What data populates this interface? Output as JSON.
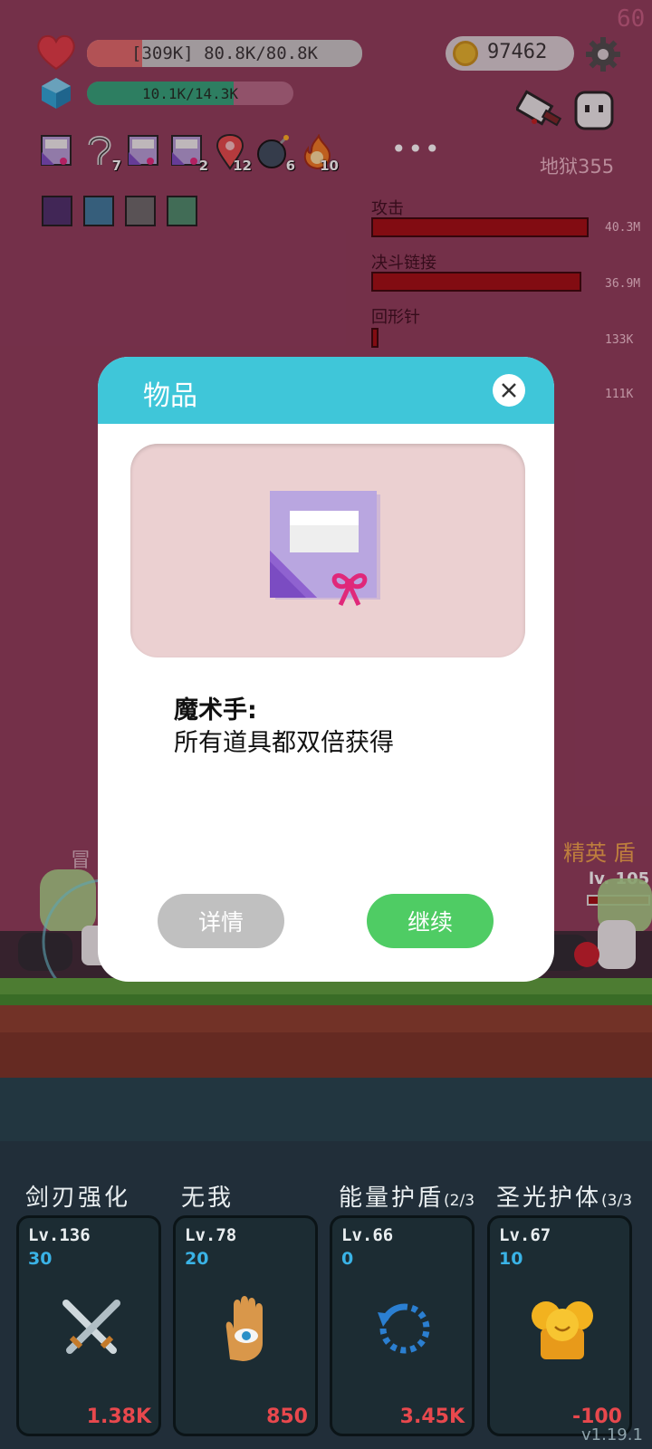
{
  "hud": {
    "fps": "60",
    "hp_text": "[309K] 80.8K/80.8K",
    "hp_fraction": 1.0,
    "mana_text": "10.1K/14.3K",
    "mana_fraction": 0.71,
    "coins": "97462",
    "level_label": "地狱355"
  },
  "buffs": [
    {
      "icon": "magic-hand-icon",
      "count": ""
    },
    {
      "icon": "hook-icon",
      "count": "7"
    },
    {
      "icon": "magic-hand-icon",
      "count": ""
    },
    {
      "icon": "magic-hand-icon",
      "count": "2"
    },
    {
      "icon": "map-pin-icon",
      "count": "12"
    },
    {
      "icon": "bomb-icon",
      "count": "6"
    },
    {
      "icon": "fire-icon",
      "count": "10"
    }
  ],
  "more_label": "•••",
  "damage": [
    {
      "label": "攻击",
      "value": "40.3M"
    },
    {
      "label": "决斗链接",
      "value": "36.9M"
    },
    {
      "label": "回形针",
      "value": "133K"
    },
    {
      "label": "",
      "value": "111K"
    }
  ],
  "enemy_left_label": "冒",
  "enemy_right": {
    "label": "精英 盾",
    "level": "lv. 105"
  },
  "modal": {
    "title": "物品",
    "item_name": "魔术手:",
    "item_desc": "所有道具都双倍获得",
    "detail_button": "详情",
    "continue_button": "继续"
  },
  "skills": [
    {
      "name": "剑刃强化",
      "suffix": "",
      "level": "Lv.136",
      "cost": "30",
      "value": "1.38K",
      "icon": "crossed-swords-icon"
    },
    {
      "name": "无我",
      "suffix": "",
      "level": "Lv.78",
      "cost": "20",
      "value": "850",
      "icon": "eye-hand-icon"
    },
    {
      "name": "能量护盾",
      "suffix": "(2/3",
      "level": "Lv.66",
      "cost": "0",
      "value": "3.45K",
      "icon": "refresh-icon"
    },
    {
      "name": "圣光护体",
      "suffix": "(3/3",
      "level": "Lv.67",
      "cost": "10",
      "value": "-100",
      "icon": "golden-statue-icon"
    }
  ],
  "version": "v1.19.1",
  "colors": {
    "background": "#8e3d5a",
    "modal_header": "#3fc6d9",
    "continue_button": "#4fcc64",
    "detail_button": "#c0c0c0",
    "damage_bar": "#a10c10"
  }
}
